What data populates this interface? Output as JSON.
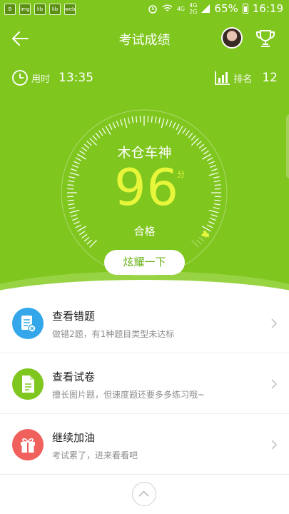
{
  "status_bar": {
    "app_icons": [
      "B",
      "img",
      "lib",
      "lib",
      "web"
    ],
    "network_1": "4G",
    "network_2": "4G",
    "network_3": "2G",
    "battery": "65%",
    "time": "16:19"
  },
  "header": {
    "title": "考试成绩"
  },
  "stats": {
    "time_label": "用时",
    "time_value": "13:35",
    "rank_label": "排名",
    "rank_value": "12"
  },
  "result": {
    "name": "木仓车神",
    "score": "96",
    "unit": "分",
    "status": "合格",
    "score_fraction": 0.96
  },
  "share_button": "炫耀一下",
  "list": [
    {
      "title": "查看错题",
      "subtitle": "做错2题，有1种题目类型未达标",
      "icon": "wrong-questions-icon",
      "color": "#33a7ea"
    },
    {
      "title": "查看试卷",
      "subtitle": "擅长图片题，但速度题还要多多练习哦~",
      "icon": "exam-paper-icon",
      "color": "#7fc61e"
    },
    {
      "title": "继续加油",
      "subtitle": "考试累了，进来看看吧",
      "icon": "gift-icon",
      "color": "#f0605c"
    }
  ],
  "colors": {
    "primary": "#7fc61e",
    "score": "#e7f63b"
  }
}
